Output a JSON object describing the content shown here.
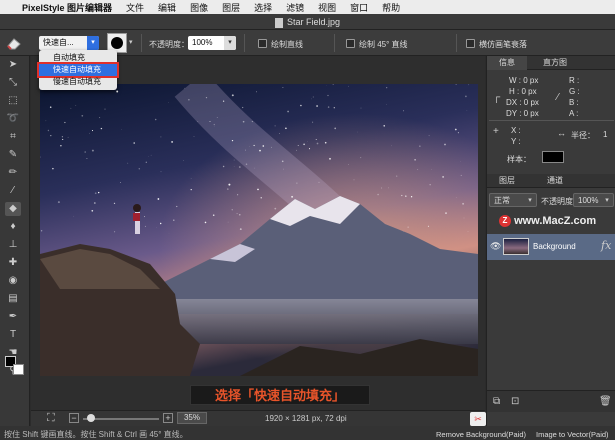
{
  "menubar": {
    "app_name": "PixelStyle 图片编辑器",
    "items": [
      "文件",
      "编辑",
      "图像",
      "图层",
      "选择",
      "滤镜",
      "视图",
      "窗口",
      "帮助"
    ]
  },
  "window": {
    "title": "Star Field.jpg"
  },
  "options": {
    "fill_mode_value": "快速自...",
    "opacity_label": "不透明度：",
    "opacity_value": "100%",
    "draw_line_label": "绘制直线",
    "draw_45_label": "绘制 45° 直线",
    "tilt_label": "横仿画笔衰落"
  },
  "fill_menu": {
    "items": [
      "自动填充",
      "快速自动填充",
      "慢速自动填充"
    ],
    "selected_index": 1
  },
  "caption": "选择「快速自动填充」",
  "status": {
    "zoom": "35%",
    "dimensions": "1920 × 1281 px, 72 dpi"
  },
  "footer": {
    "hint": "按住 Shift 键画直线。按住 Shift & Ctrl 画 45° 直线。",
    "remove_bg_label": "Remove Background(Paid)",
    "vector_label": "Image to Vector(Paid)"
  },
  "info_panel": {
    "tab_info": "信息",
    "tab_histogram": "直方图",
    "w": "W : 0 px",
    "h": "H : 0 px",
    "dx": "DX : 0 px",
    "dy": "DY : 0 px",
    "r": "R :",
    "g": "G :",
    "b": "B :",
    "a": "A :",
    "x": "X :",
    "y": "Y :",
    "radius_label": "半径：",
    "radius_value": "1",
    "sample_label": "样本："
  },
  "layers_panel": {
    "tab_layers": "图层",
    "tab_channels": "通道",
    "blend_mode": "正常",
    "opacity_label": "不透明度",
    "opacity_value": "100%",
    "layer_name": "Background",
    "watermark": "www.MacZ.com"
  },
  "colors": {
    "accent": "#2f6fe0",
    "highlight": "#e0302a",
    "caption_text": "#e8542a"
  }
}
